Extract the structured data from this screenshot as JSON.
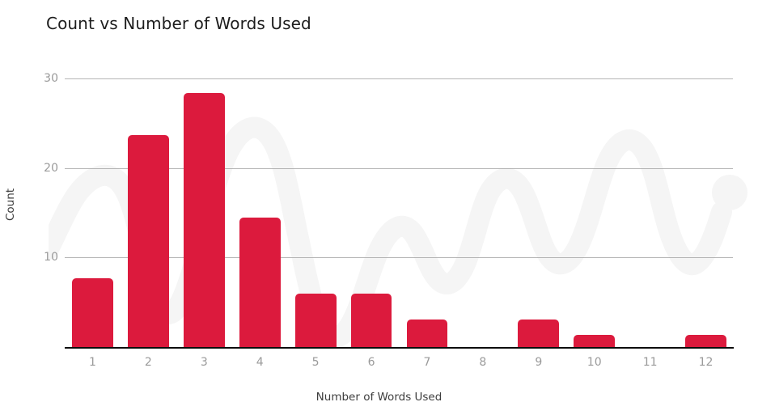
{
  "chart_data": {
    "type": "bar",
    "title": "Count vs Number of Words Used",
    "xlabel": "Number of Words Used",
    "ylabel": "Count",
    "categories": [
      "1",
      "2",
      "3",
      "4",
      "5",
      "6",
      "7",
      "8",
      "9",
      "10",
      "11",
      "12"
    ],
    "values": [
      7.7,
      23.7,
      28.4,
      14.5,
      6,
      6,
      3.1,
      0,
      3.1,
      1.4,
      0,
      1.4
    ],
    "series": [
      {
        "name": "Count",
        "values": [
          7.7,
          23.7,
          28.4,
          14.5,
          6,
          6,
          3.1,
          0,
          3.1,
          1.4,
          0,
          1.4
        ]
      }
    ],
    "ytick_labels": [
      "10",
      "20",
      "30"
    ],
    "ytick_values": [
      10,
      20,
      30
    ],
    "ylim": [
      0,
      30
    ],
    "xlim_categories": 12,
    "grid": true,
    "grid_axis": "y",
    "legend": false,
    "legend_position": "none",
    "bar_color": "#dc1a3d",
    "grid_color": "#9e9e9e",
    "axis_color": "#0d0d0d",
    "tick_label_color": "#9a9a9a",
    "title_color": "#1d1d1d",
    "axis_title_color": "#3d3d3d",
    "background_color": "#ffffff",
    "watermark_color": "#f5f5f5"
  }
}
